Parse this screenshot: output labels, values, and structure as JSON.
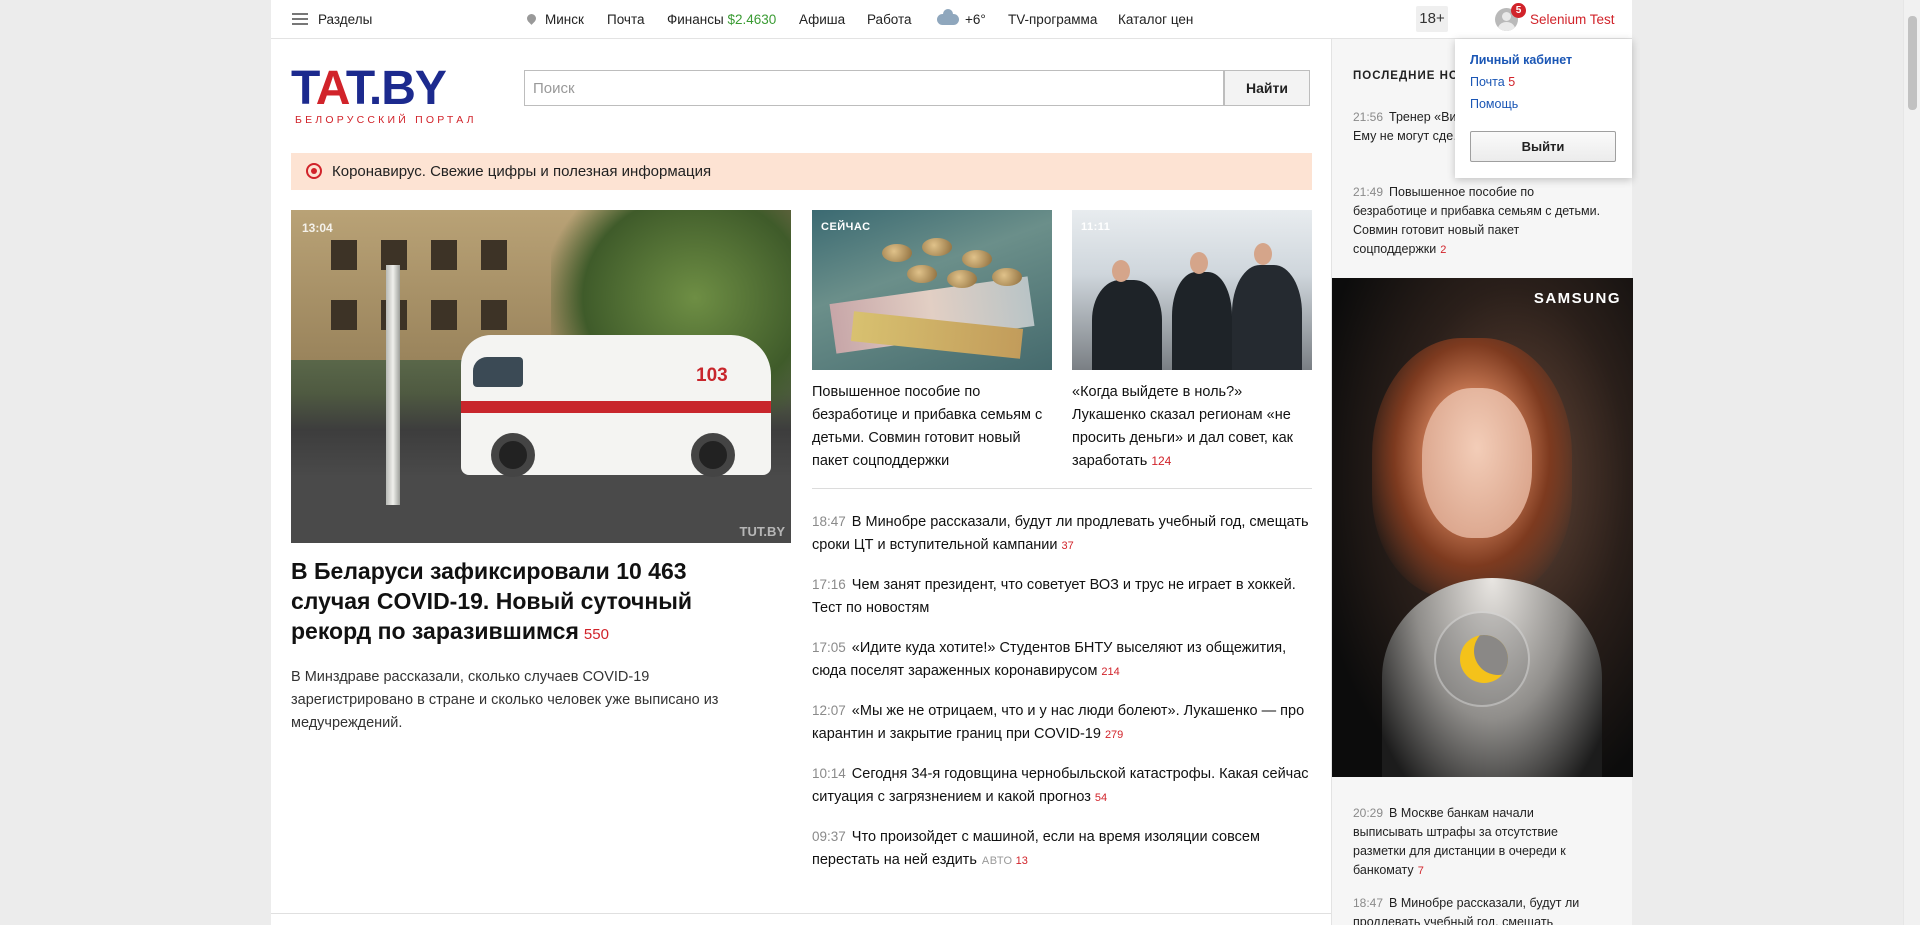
{
  "topbar": {
    "sections": "Разделы",
    "city": "Минск",
    "mail": "Почта",
    "finance": "Финансы",
    "finance_rate": "$2.4630",
    "afisha": "Афиша",
    "jobs": "Работа",
    "weather": "+6°",
    "tv": "TV-программа",
    "prices": "Каталог цен",
    "age": "18+",
    "notifications": "5",
    "user": "Selenium Test"
  },
  "header": {
    "logo_a": "T",
    "logo_b": "A",
    "logo_c": "T.BY",
    "logo_sub": "БЕЛОРУССКИЙ ПОРТАЛ",
    "search_placeholder": "Поиск",
    "search_button": "Найти"
  },
  "corona": "Коронавирус. Свежие цифры и полезная информация",
  "main_story": {
    "time": "13:04",
    "watermark": "TUT.BY",
    "title": "В Беларуси зафиксировали 10 463 случая COVID-19. Новый суточный рекорд по заразившимся",
    "comments": "550",
    "desc": "В Минздраве рассказали, сколько случаев COVID-19 зарегистрировано в стране и сколько человек уже выписано из медучреждений."
  },
  "van_number": "103",
  "cards": [
    {
      "tag": "СЕЙЧАС",
      "title": "Повышенное пособие по безработице и прибавка семьям с детьми. Совмин готовит новый пакет соцподдержки",
      "comments": ""
    },
    {
      "tag": "11:11",
      "title": "«Когда выйдете в ноль?» Лукашенко сказал регионам «не просить деньги» и дал совет, как заработать",
      "comments": "124"
    }
  ],
  "news": [
    {
      "time": "18:47",
      "title": "В Минобре рассказали, будут ли продлевать учебный год, смещать сроки ЦТ и вступительной кампании",
      "rubric": "",
      "comments": "37"
    },
    {
      "time": "17:16",
      "title": "Чем занят президент, что советует ВОЗ и трус не играет в хоккей. Тест по новостям",
      "rubric": "",
      "comments": ""
    },
    {
      "time": "17:05",
      "title": "«Идите куда хотите!» Студентов БНТУ выселяют из общежития, сюда поселят зараженных коронавирусом",
      "rubric": "",
      "comments": "214"
    },
    {
      "time": "12:07",
      "title": "«Мы же не отрицаем, что и у нас люди болеют». Лукашенко — про карантин и закрытие границ при COVID-19",
      "rubric": "",
      "comments": "279"
    },
    {
      "time": "10:14",
      "title": "Сегодня 34-я годовщина чернобыльской катастрофы. Какая сейчас ситуация с загрязнением и какой прогноз",
      "rubric": "",
      "comments": "54"
    },
    {
      "time": "09:37",
      "title": "Что произойдет с машиной, если на время изоляции совсем перестать на ней ездить",
      "rubric": "АВТО",
      "comments": "13"
    }
  ],
  "right": {
    "title": "ПОСЛЕДНИЕ НО",
    "news": [
      {
        "time": "21:56",
        "title": "Тренер «Ви… о футболисте, ко… Ему не могут сде…",
        "comments": ""
      },
      {
        "time": "21:49",
        "title": "Повышенное пособие по безработице и прибавка семьям с детьми. Совмин готовит новый пакет соцподдержки",
        "comments": "2"
      },
      {
        "time": "20:29",
        "title": "В Москве банкам начали выписывать штрафы за отсутствие разметки для дистанции в очереди к банкомату",
        "comments": "7"
      },
      {
        "time": "18:47",
        "title": "В Минобре рассказали, будут ли продлевать учебный год, смещать",
        "comments": ""
      }
    ],
    "ad_brand": "SAMSUNG"
  },
  "dropdown": {
    "cabinet": "Личный кабинет",
    "mail": "Почта",
    "mail_count": "5",
    "help": "Помощь",
    "logout": "Выйти"
  }
}
